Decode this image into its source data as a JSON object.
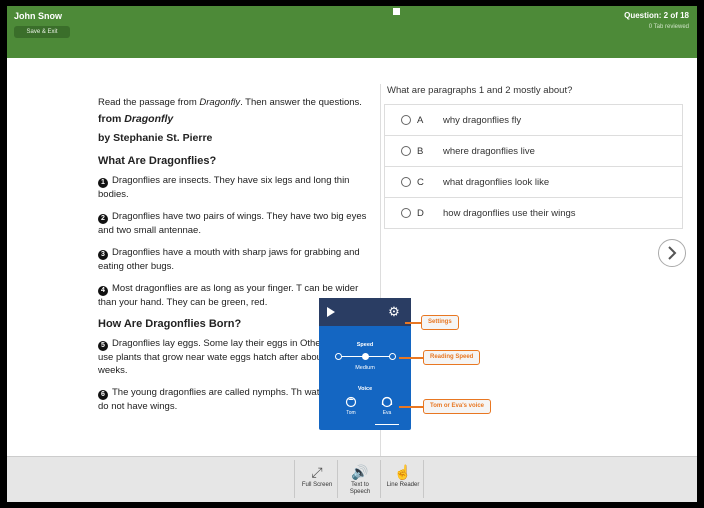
{
  "header": {
    "student_name": "John Snow",
    "save_exit": "Save & Exit",
    "question_count": "Question: 2 of 18",
    "reviewed": "0 Tab reviewed"
  },
  "passage": {
    "intro_pre": "Read the passage from ",
    "intro_title": "Dragonfly",
    "intro_post": ". Then answer the questions.",
    "from_pre": "from ",
    "from_title": "Dragonfly",
    "byline": "by Stephanie St. Pierre",
    "section1_heading": "What Are Dragonflies?",
    "section2_heading": "How Are Dragonflies Born?",
    "paragraphs": [
      {
        "num": "1",
        "text": "Dragonflies are insects. They have six legs and long thin bodies."
      },
      {
        "num": "2",
        "text": "Dragonflies have two pairs of wings. They have two big eyes and two small antennae."
      },
      {
        "num": "3",
        "text": "Dragonflies have a mouth with sharp jaws for grabbing and eating other bugs."
      },
      {
        "num": "4",
        "text": "Most dragonflies are as long as your finger. T can be wider than your hand. They can be green, red."
      },
      {
        "num": "5",
        "text": "Dragonflies lay eggs. Some lay their eggs in Other dragonflies use plants that grow near wate eggs hatch after about four weeks."
      },
      {
        "num": "6",
        "text": "The young dragonflies are called nymphs. Th water. Nymphs do not have wings."
      }
    ]
  },
  "question": {
    "text": "What are paragraphs 1 and 2 mostly about?",
    "options": [
      {
        "letter": "A",
        "text": "why dragonflies fly"
      },
      {
        "letter": "B",
        "text": "where dragonflies live"
      },
      {
        "letter": "C",
        "text": "what dragonflies look like"
      },
      {
        "letter": "D",
        "text": "how dragonflies use their wings"
      }
    ]
  },
  "tts_panel": {
    "speed_label": "Speed",
    "speed_value": "Medium",
    "voice_label": "Voice",
    "voice_tom": "Tom",
    "voice_eva": "Eva"
  },
  "callouts": {
    "settings": "Settings",
    "reading_speed": "Reading Speed",
    "voice": "Tom or Eva's voice"
  },
  "toolbar": {
    "full_screen": "Full Screen",
    "text_to_speech": "Text to Speech",
    "line_reader": "Line Reader"
  },
  "colors": {
    "header": "#4d8a38",
    "tts_panel": "#1466c2",
    "callout": "#e87722"
  }
}
